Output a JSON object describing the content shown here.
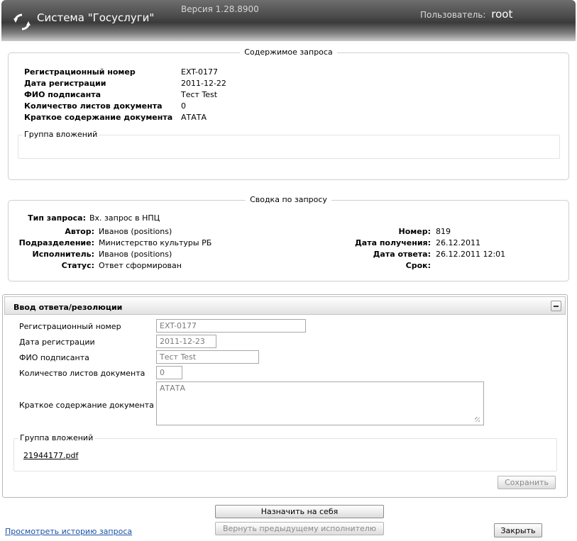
{
  "header": {
    "title": "Система \"Госуслуги\"",
    "version": "Версия 1.28.8900",
    "user_label": "Пользователь:",
    "user_name": "root"
  },
  "request_content": {
    "legend": "Содержимое запроса",
    "fields": [
      {
        "label": "Регистрационный номер",
        "value": "EXT-0177"
      },
      {
        "label": "Дата регистрации",
        "value": "2011-12-22"
      },
      {
        "label": "ФИО подписанта",
        "value": "Тест Test"
      },
      {
        "label": "Количество листов документа",
        "value": "0"
      },
      {
        "label": "Краткое содержание документа",
        "value": "АТАТА"
      }
    ],
    "attachments_label": "Группа вложений"
  },
  "summary": {
    "legend": "Сводка по запросу",
    "left": [
      {
        "label": "Тип запроса:",
        "value": "Вх. запрос в НПЦ"
      },
      {
        "label": "Автор:",
        "value": "Иванов (positions)"
      },
      {
        "label": "Подразделение:",
        "value": "Министерство культуры РБ"
      },
      {
        "label": "Исполнитель:",
        "value": "Иванов (positions)"
      },
      {
        "label": "Статус:",
        "value": "Ответ сформирован"
      }
    ],
    "right": [
      {
        "label": "Номер:",
        "value": "819"
      },
      {
        "label": "Дата получения:",
        "value": "26.12.2011"
      },
      {
        "label": "Дата ответа:",
        "value": "26.12.2011 12:01"
      },
      {
        "label": "Срок:",
        "value": ""
      }
    ]
  },
  "reply": {
    "title": "Ввод ответа/резолюции",
    "fields": [
      {
        "label": "Регистрационный номер",
        "value": "EXT-0177"
      },
      {
        "label": "Дата регистрации",
        "value": "2011-12-23"
      },
      {
        "label": "ФИО подписанта",
        "value": "Тест Test"
      },
      {
        "label": "Количество листов документа",
        "value": "0"
      },
      {
        "label": "Краткое содержание документа",
        "value": "АТАТА"
      }
    ],
    "attachments_label": "Группа вложений",
    "attachment_file": "21944177.pdf",
    "save_label": "Сохранить"
  },
  "actions": {
    "assign_label": "Назначить на себя",
    "return_label": "Вернуть предыдущему исполнителю",
    "history_link": "Просмотреть историю запроса",
    "close_label": "Закрыть"
  },
  "colors": {
    "link": "#1a50a8",
    "header_dark": "#3a3a3a"
  }
}
